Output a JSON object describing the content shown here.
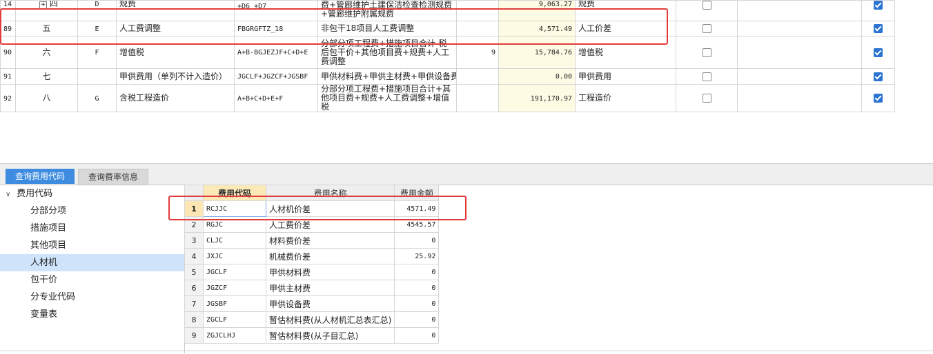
{
  "top_rows": [
    {
      "row": "14",
      "seq": "四",
      "code": "D",
      "name": "规费",
      "formula": "+D6 +D7",
      "base": "费+管廊维护土建保洁检查检测规费+管廊维护附属规费",
      "rate": "",
      "amount": "9,063.27",
      "type": "规费",
      "checked": false,
      "enabled": true,
      "has_expander": true
    },
    {
      "row": "89",
      "seq": "五",
      "code": "E",
      "name": "人工费调整",
      "formula": "FBGRGFTZ_18",
      "base": "非包干18项目人工费调整",
      "rate": "",
      "amount": "4,571.49",
      "type": "人工价差",
      "checked": false,
      "enabled": true
    },
    {
      "row": "90",
      "seq": "六",
      "code": "F",
      "name": "增值税",
      "formula": "A+B-BGJEZJF+C+D+E",
      "base": "分部分项工程费+措施项目合计-税后包干价+其他项目费+规费+人工费调整",
      "rate": "9",
      "amount": "15,784.76",
      "type": "增值税",
      "checked": false,
      "enabled": true
    },
    {
      "row": "91",
      "seq": "七",
      "code": "",
      "name": "甲供费用（单列不计入造价）",
      "formula": "JGCLF+JGZCF+JGSBF",
      "base": "甲供材料费+甲供主材费+甲供设备费",
      "rate": "",
      "amount": "0.00",
      "type": "甲供费用",
      "checked": false,
      "enabled": true
    },
    {
      "row": "92",
      "seq": "八",
      "code": "G",
      "name": "含税工程造价",
      "formula": "A+B+C+D+E+F",
      "base": "分部分项工程费+措施项目合计+其他项目费+规费+人工费调整+增值税",
      "rate": "",
      "amount": "191,170.97",
      "type": "工程造价",
      "checked": false,
      "enabled": true
    }
  ],
  "tabs": {
    "query_code": "查询费用代码",
    "query_rate": "查询费率信息"
  },
  "tree": {
    "root": "费用代码",
    "items": [
      "分部分项",
      "措施项目",
      "其他项目",
      "人材机",
      "包干价",
      "分专业代码",
      "变量表"
    ],
    "selected": "人材机"
  },
  "code_grid": {
    "headers": {
      "code": "费用代码",
      "name": "费用名称",
      "amount": "费用金额"
    },
    "rows": [
      {
        "n": "1",
        "code": "RCJJC",
        "name": "人材机价差",
        "amount": "4571.49"
      },
      {
        "n": "2",
        "code": "RGJC",
        "name": "人工费价差",
        "amount": "4545.57"
      },
      {
        "n": "3",
        "code": "CLJC",
        "name": "材料费价差",
        "amount": "0"
      },
      {
        "n": "4",
        "code": "JXJC",
        "name": "机械费价差",
        "amount": "25.92"
      },
      {
        "n": "5",
        "code": "JGCLF",
        "name": "甲供材料费",
        "amount": "0"
      },
      {
        "n": "6",
        "code": "JGZCF",
        "name": "甲供主材费",
        "amount": "0"
      },
      {
        "n": "7",
        "code": "JGSBF",
        "name": "甲供设备费",
        "amount": "0"
      },
      {
        "n": "8",
        "code": "ZGCLF",
        "name": "暂估材料费(从人材机汇总表汇总)",
        "amount": "0"
      },
      {
        "n": "9",
        "code": "ZGJCLHJ",
        "name": "暂估材料费(从子目汇总)",
        "amount": "0"
      }
    ]
  },
  "colors": {
    "accent": "#3d8ce0",
    "annotation": "#e23b3b",
    "amount_bg": "#fdfbe3",
    "selected_bg": "#cfe4fb"
  }
}
